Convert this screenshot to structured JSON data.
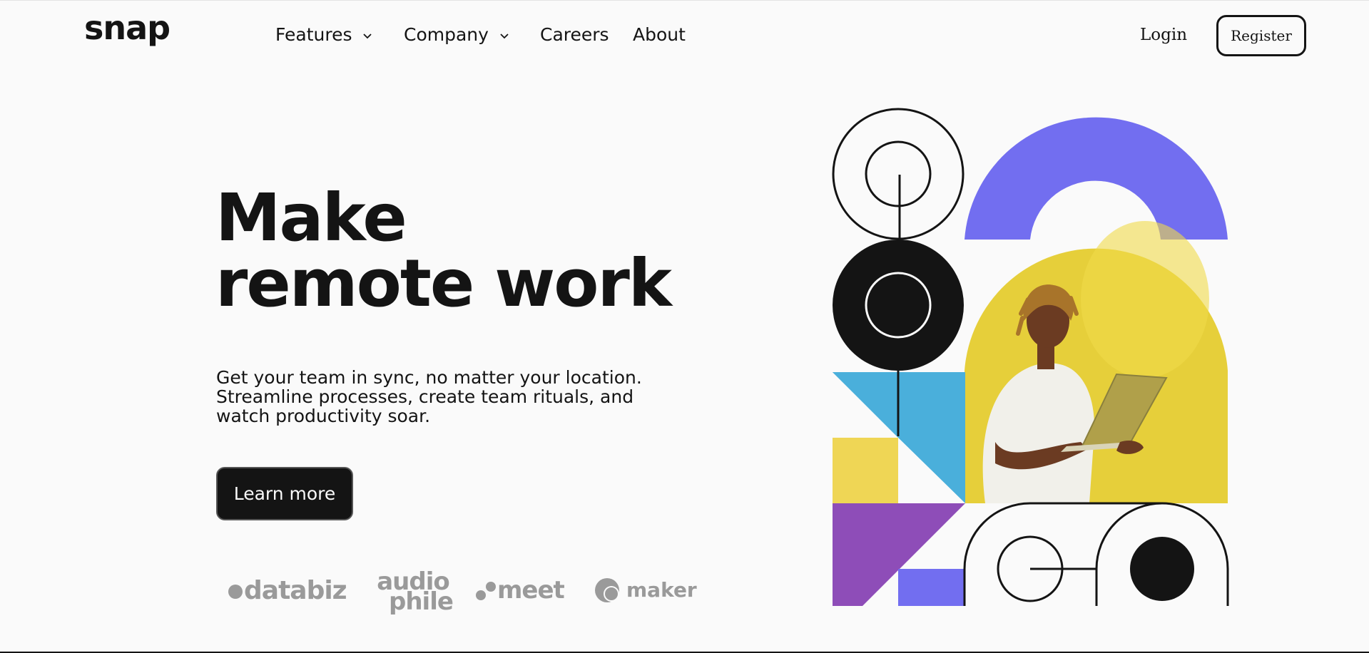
{
  "brand": {
    "logo": "snap"
  },
  "nav": {
    "items": [
      {
        "label": "Features",
        "has_dropdown": true
      },
      {
        "label": "Company",
        "has_dropdown": true
      },
      {
        "label": "Careers",
        "has_dropdown": false
      },
      {
        "label": "About",
        "has_dropdown": false
      }
    ]
  },
  "auth": {
    "login_label": "Login",
    "register_label": "Register"
  },
  "hero": {
    "title_line1": "Make",
    "title_line2": "remote work",
    "description": "Get your team in sync, no matter your location. Streamline processes, create team rituals, and watch productivity soar.",
    "cta_label": "Learn more"
  },
  "clients": {
    "logos": [
      {
        "name": "databiz"
      },
      {
        "name_line1": "audio",
        "name_line2": "phile"
      },
      {
        "name": "meet"
      },
      {
        "name": "maker"
      }
    ]
  },
  "colors": {
    "background": "#fafafa",
    "text": "#141414",
    "purple": "#726ef0",
    "yellow_photo": "#e6cf3a",
    "yellow_block": "#efd655",
    "blue": "#4aafdb",
    "violet": "#8e4db8",
    "client_gray": "#9a9a9a"
  },
  "icons": {
    "dropdown": "chevron-down-icon"
  }
}
